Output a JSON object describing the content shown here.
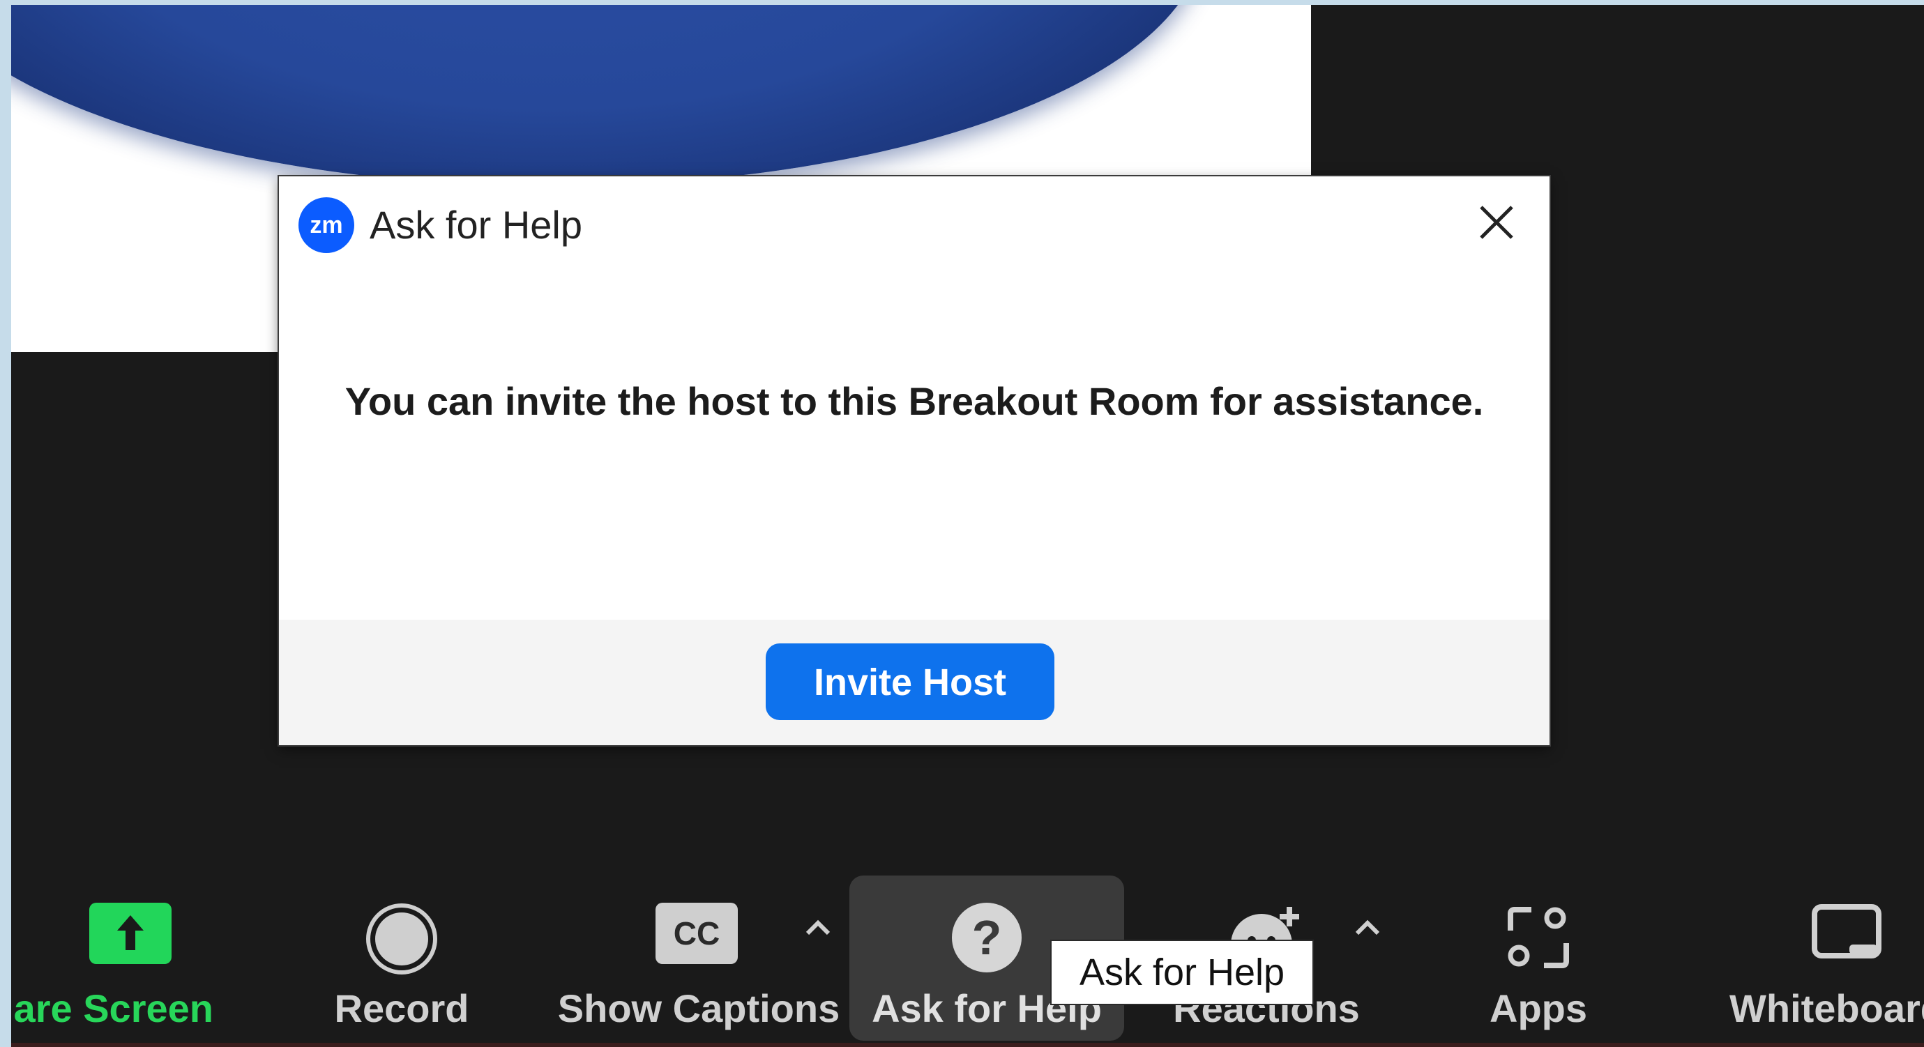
{
  "dialog": {
    "logo_text": "zm",
    "title": "Ask for Help",
    "message": "You can invite the host to this Breakout Room for assistance.",
    "primary_button": "Invite Host"
  },
  "toolbar": {
    "share_screen": "are Screen",
    "record": "Record",
    "show_captions": "Show Captions",
    "captions_icon_text": "CC",
    "ask_for_help": "Ask for Help",
    "ask_icon_text": "?",
    "reactions": "Reactions",
    "apps": "Apps",
    "whiteboard": "Whiteboard"
  },
  "tooltip": {
    "text": "Ask for Help"
  },
  "colors": {
    "accent_blue": "#0e72ed",
    "share_green": "#28d65a",
    "toolbar_bg": "#1a1a1a"
  }
}
